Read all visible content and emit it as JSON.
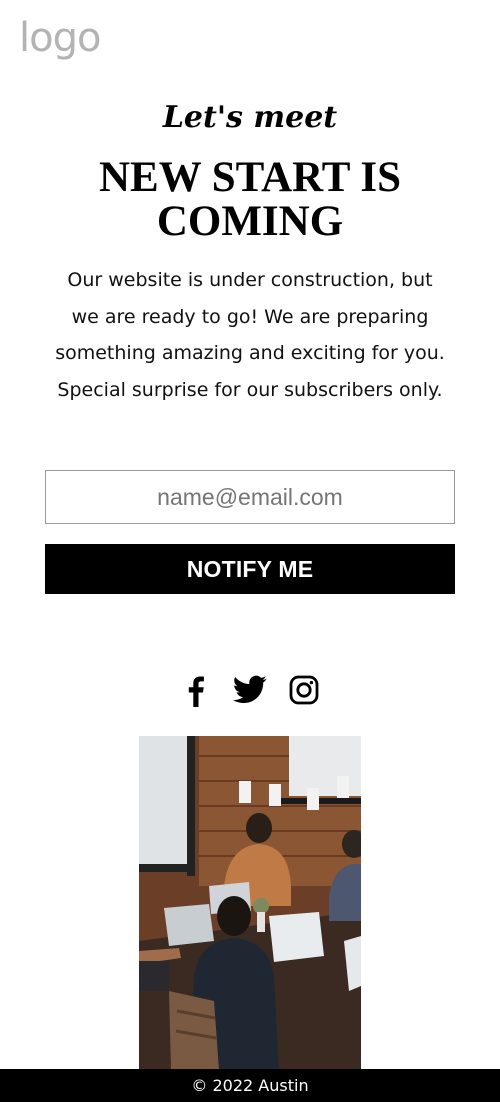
{
  "header": {
    "logo_text": "logo"
  },
  "hero": {
    "eyebrow": "Let's meet",
    "title": "NEW START IS COMING",
    "description": "Our website is under construction, but we are ready to go! We are preparing something amazing and exciting for you. Special surprise for our subscribers only."
  },
  "signup": {
    "email_placeholder": "name@email.com",
    "email_value": "",
    "button_label": "NOTIFY ME"
  },
  "social": {
    "icons": [
      "facebook-icon",
      "twitter-icon",
      "instagram-icon"
    ]
  },
  "footer": {
    "text": "© 2022 Austin"
  },
  "colors": {
    "accent": "#000000",
    "background": "#ffffff",
    "logo": "#b3b3b3",
    "footer_text": "#ffffff"
  }
}
